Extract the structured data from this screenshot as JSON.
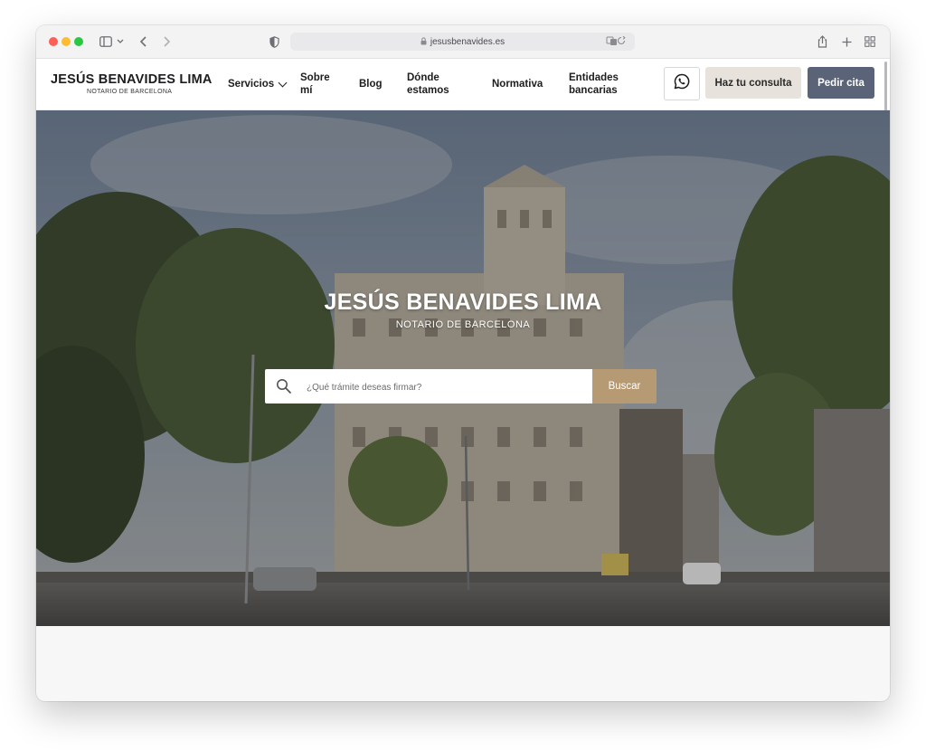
{
  "browser": {
    "url": "jesusbenavides.es",
    "icons": [
      "sidebar-icon",
      "chevron-down-icon",
      "back-icon",
      "forward-icon",
      "shield-icon",
      "lock-icon",
      "translate-icon",
      "reload-icon",
      "share-icon",
      "new-tab-icon",
      "tab-overview-icon"
    ]
  },
  "header": {
    "logo_title": "JESÚS BENAVIDES LIMA",
    "logo_subtitle": "NOTARIO DE BARCELONA",
    "nav": {
      "servicios": "Servicios",
      "sobre_1": "Sobre",
      "sobre_2": "mí",
      "blog": "Blog",
      "donde_1": "Dónde",
      "donde_2": "estamos",
      "normativa": "Normativa",
      "entidades_1": "Entidades",
      "entidades_2": "bancarias"
    },
    "consulta_label": "Haz tu consulta",
    "cita_label": "Pedir cita"
  },
  "hero": {
    "title": "JESÚS BENAVIDES LIMA",
    "subtitle": "NOTARIO DE BARCELONA",
    "search_placeholder": "¿Qué trámite deseas firmar?",
    "search_button": "Buscar"
  },
  "colors": {
    "brand_gold": "#b59a74",
    "cita_button": "#5a6377",
    "consulta_button": "#e7e3dc"
  }
}
